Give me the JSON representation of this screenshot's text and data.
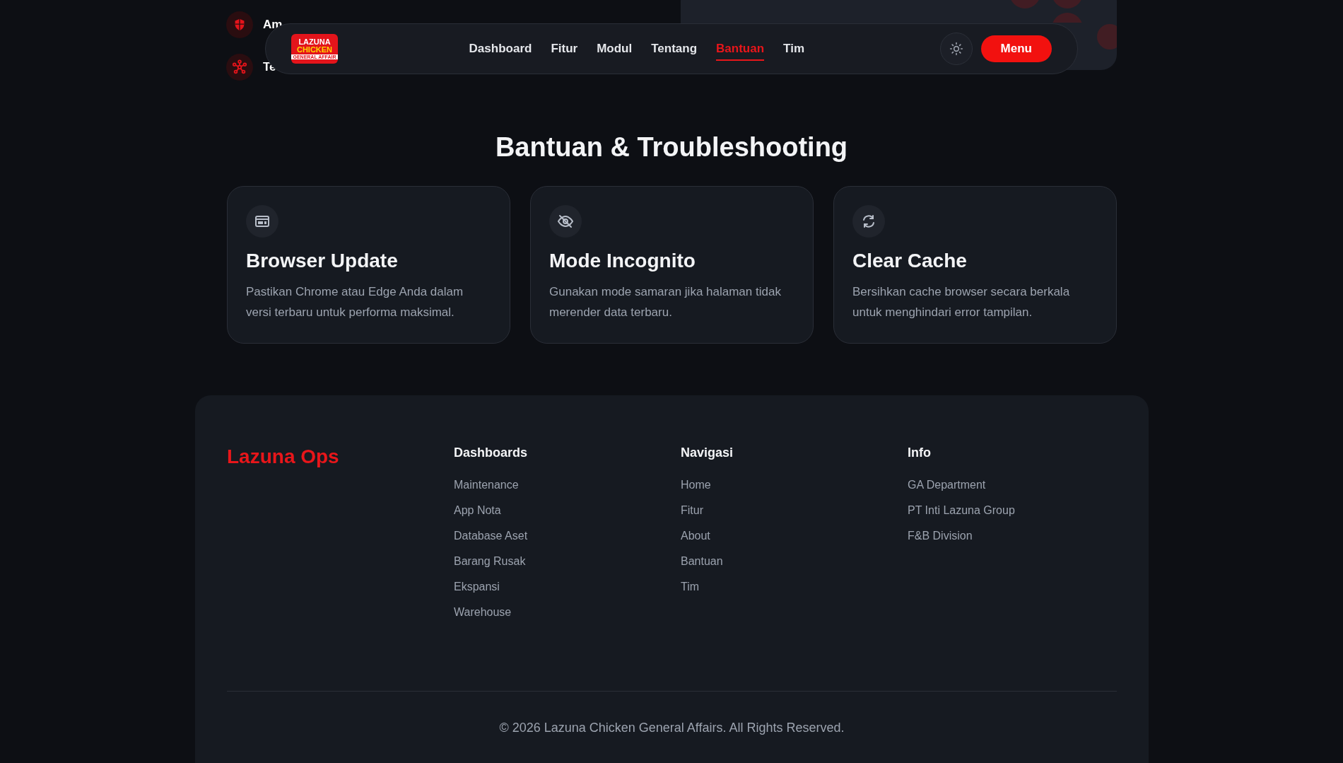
{
  "background_items": [
    {
      "kind": "shield",
      "label": "Am"
    },
    {
      "kind": "network",
      "label": "Te"
    }
  ],
  "navbar": {
    "logo": {
      "line_1": "LAZUNA",
      "line_2": "CHICKEN",
      "line_3": "GENERAL AFFAIR"
    },
    "links": [
      {
        "label": "Dashboard",
        "selected": false
      },
      {
        "label": "Fitur",
        "selected": false
      },
      {
        "label": "Modul",
        "selected": false
      },
      {
        "label": "Tentang",
        "selected": false
      },
      {
        "label": "Bantuan",
        "selected": true
      },
      {
        "label": "Tim",
        "selected": false
      }
    ],
    "menu_button": "Menu"
  },
  "help": {
    "title": "Bantuan & Troubleshooting",
    "cards": [
      {
        "kind": "browser",
        "title": "Browser Update",
        "text": "Pastikan Chrome atau Edge Anda dalam versi terbaru untuk performa maksimal."
      },
      {
        "kind": "incognito",
        "title": "Mode Incognito",
        "text": "Gunakan mode samaran jika halaman tidak merender data terbaru."
      },
      {
        "kind": "refresh",
        "title": "Clear Cache",
        "text": "Bersihkan cache browser secara berkala untuk menghindari error tampilan."
      }
    ]
  },
  "footer": {
    "brand": "Lazuna Ops",
    "columns": [
      {
        "title": "Dashboards",
        "links": [
          "Maintenance",
          "App Nota",
          "Database Aset",
          "Barang Rusak",
          "Ekspansi",
          "Warehouse"
        ]
      },
      {
        "title": "Navigasi",
        "links": [
          "Home",
          "Fitur",
          "About",
          "Bantuan",
          "Tim"
        ]
      },
      {
        "title": "Info",
        "links": [
          "GA Department",
          "PT Inti Lazuna Group",
          "F&B Division"
        ]
      }
    ],
    "copyright": "© 2026 Lazuna Chicken General Affairs. All Rights Reserved."
  }
}
